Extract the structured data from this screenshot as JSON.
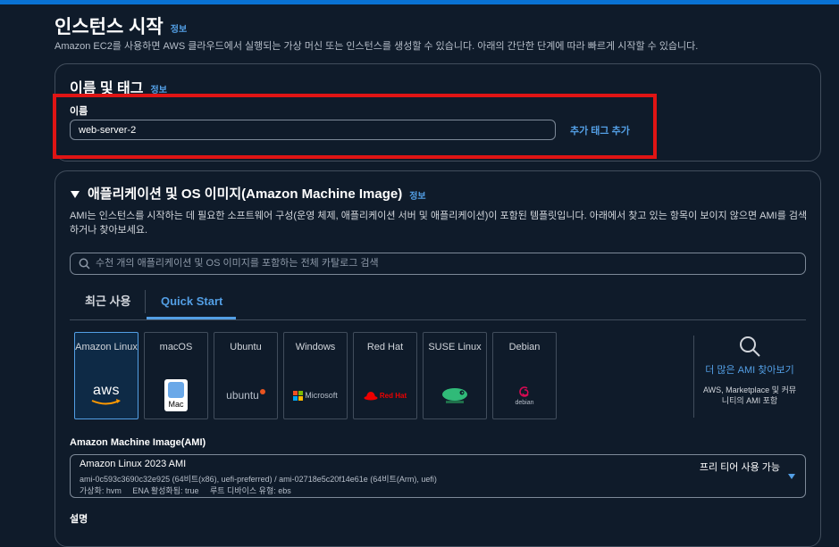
{
  "page": {
    "title": "인스턴스 시작",
    "info": "정보",
    "subtitle": "Amazon EC2를 사용하면 AWS 클라우드에서 실행되는 가상 머신 또는 인스턴스를 생성할 수 있습니다. 아래의 간단한 단계에 따라 빠르게 시작할 수 있습니다."
  },
  "name_tags": {
    "title": "이름 및 태그",
    "info": "정보",
    "name_label": "이름",
    "name_value": "web-server-2",
    "add_tags": "추가 태그 추가"
  },
  "ami_section": {
    "title": "애플리케이션 및 OS 이미지(Amazon Machine Image)",
    "info": "정보",
    "description": "AMI는 인스턴스를 시작하는 데 필요한 소프트웨어 구성(운영 체제, 애플리케이션 서버 및 애플리케이션)이 포함된 템플릿입니다. 아래에서 찾고 있는 항목이 보이지 않으면 AMI를 검색하거나 찾아보세요.",
    "search_placeholder": "수천 개의 애플리케이션 및 OS 이미지를 포함하는 전체 카탈로그 검색",
    "tabs": [
      {
        "label": "최근 사용",
        "active": false
      },
      {
        "label": "Quick Start",
        "active": true
      }
    ],
    "os_options": [
      {
        "name": "Amazon Linux",
        "logo_text": "aws",
        "icon": "aws-logo-icon",
        "selected": true
      },
      {
        "name": "macOS",
        "logo_text": "Mac",
        "icon": "mac-finder-icon",
        "selected": false
      },
      {
        "name": "Ubuntu",
        "logo_text": "ubuntu",
        "icon": "ubuntu-logo-icon",
        "selected": false
      },
      {
        "name": "Windows",
        "logo_text": "Microsoft",
        "icon": "microsoft-logo-icon",
        "selected": false
      },
      {
        "name": "Red Hat",
        "logo_text": "Red Hat",
        "icon": "redhat-logo-icon",
        "selected": false
      },
      {
        "name": "SUSE Linux",
        "logo_text": "",
        "icon": "suse-chameleon-icon",
        "selected": false
      },
      {
        "name": "Debian",
        "logo_text": "debian",
        "icon": "debian-swirl-icon",
        "selected": false
      }
    ],
    "more_ami": {
      "link": "더 많은 AMI 찾아보기",
      "sub": "AWS, Marketplace 및 커뮤니티의 AMI 포함"
    },
    "ami_label": "Amazon Machine Image(AMI)",
    "ami_selected": {
      "name": "Amazon Linux 2023 AMI",
      "ids": "ami-0c593c3690c32e925 (64비트(x86), uefi-preferred) / ami-02718e5c20f14e61e (64비트(Arm), uefi)",
      "attrs": "가상화: hvm     ENA 활성화됨: true     루트 디바이스 유형: ebs",
      "badge": "프리 티어 사용 가능"
    },
    "desc_label": "설명"
  },
  "colors": {
    "background": "#0f1b2a",
    "accent": "#539fe5",
    "highlight": "#e01414"
  }
}
